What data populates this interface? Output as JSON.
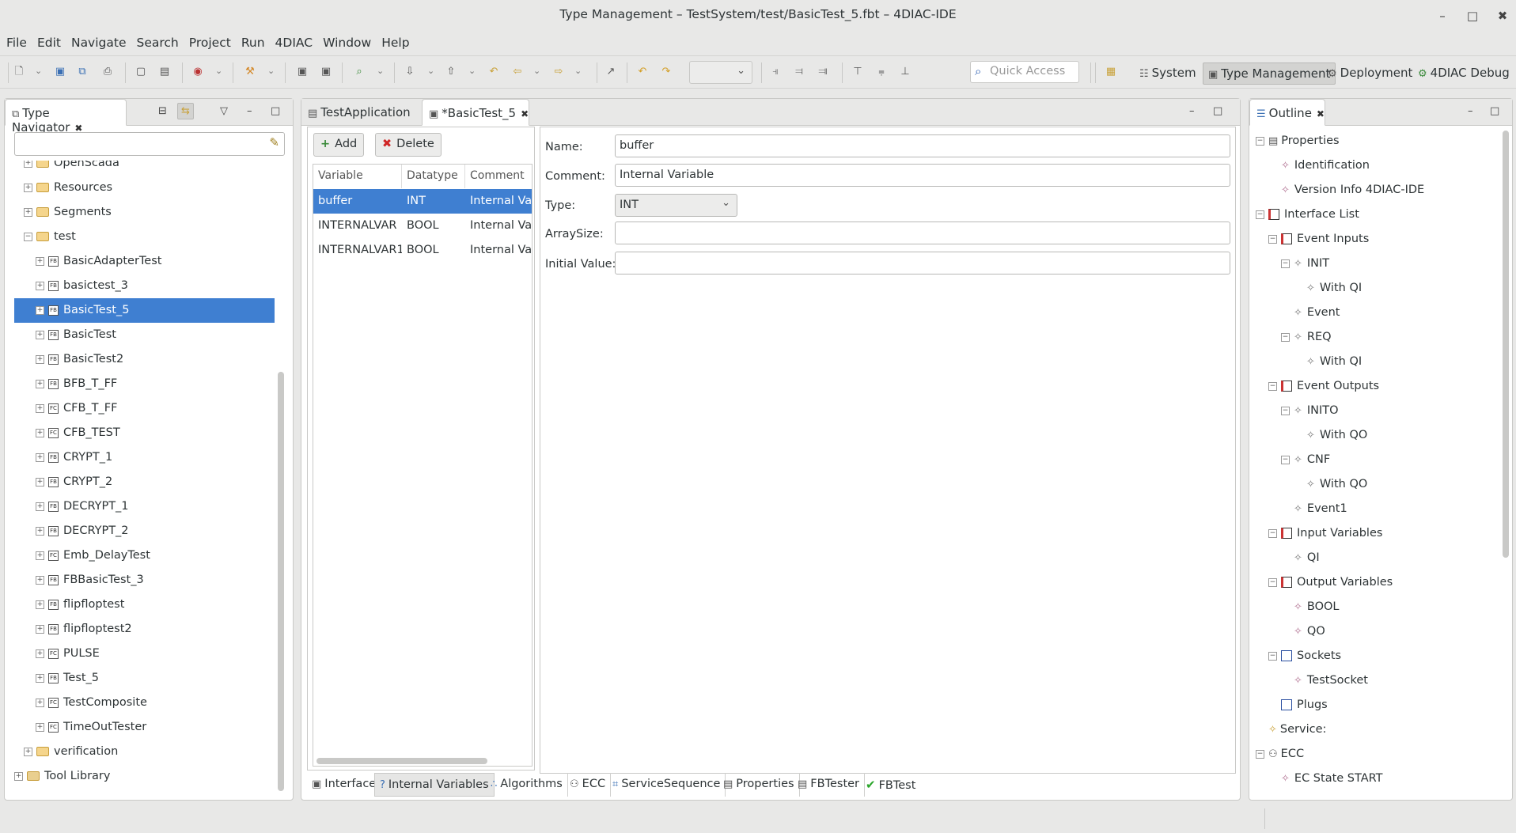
{
  "window": {
    "title": "Type Management – TestSystem/test/BasicTest_5.fbt – 4DIAC-IDE",
    "minimize": "–",
    "maximize": "□",
    "close": "✖"
  },
  "menu": [
    "File",
    "Edit",
    "Navigate",
    "Search",
    "Project",
    "Run",
    "4DIAC",
    "Window",
    "Help"
  ],
  "toolbar": {
    "quick_access_placeholder": "Quick Access",
    "perspectives": [
      "System",
      "Type Management",
      "Deployment",
      "4DIAC Debug"
    ],
    "active_perspective": "Type Management"
  },
  "type_navigator": {
    "title": "Type Navigator",
    "filter_value": "",
    "items": [
      {
        "label": "OpenScada",
        "kind": "folder",
        "level": 1
      },
      {
        "label": "Resources",
        "kind": "folder",
        "level": 1
      },
      {
        "label": "Segments",
        "kind": "folder",
        "level": 1
      },
      {
        "label": "test",
        "kind": "folder",
        "level": 1,
        "expanded": true
      },
      {
        "label": "BasicAdapterTest",
        "kind": "FB",
        "level": 2
      },
      {
        "label": "basictest_3",
        "kind": "FB",
        "level": 2
      },
      {
        "label": "BasicTest_5",
        "kind": "FB",
        "level": 2,
        "selected": true
      },
      {
        "label": "BasicTest",
        "kind": "FB",
        "level": 2
      },
      {
        "label": "BasicTest2",
        "kind": "FB",
        "level": 2
      },
      {
        "label": "BFB_T_FF",
        "kind": "FB",
        "level": 2
      },
      {
        "label": "CFB_T_FF",
        "kind": "FC",
        "level": 2
      },
      {
        "label": "CFB_TEST",
        "kind": "FC",
        "level": 2
      },
      {
        "label": "CRYPT_1",
        "kind": "FB",
        "level": 2
      },
      {
        "label": "CRYPT_2",
        "kind": "FB",
        "level": 2
      },
      {
        "label": "DECRYPT_1",
        "kind": "FB",
        "level": 2
      },
      {
        "label": "DECRYPT_2",
        "kind": "FB",
        "level": 2
      },
      {
        "label": "Emb_DelayTest",
        "kind": "FC",
        "level": 2
      },
      {
        "label": "FBBasicTest_3",
        "kind": "FB",
        "level": 2
      },
      {
        "label": "flipfloptest",
        "kind": "FB",
        "level": 2
      },
      {
        "label": "flipfloptest2",
        "kind": "FB",
        "level": 2
      },
      {
        "label": "PULSE",
        "kind": "FC",
        "level": 2
      },
      {
        "label": "Test_5",
        "kind": "FB",
        "level": 2
      },
      {
        "label": "TestComposite",
        "kind": "FC",
        "level": 2
      },
      {
        "label": "TimeOutTester",
        "kind": "FC",
        "level": 2
      },
      {
        "label": "verification",
        "kind": "folder",
        "level": 1
      },
      {
        "label": "Tool Library",
        "kind": "library",
        "level": 0
      }
    ]
  },
  "editor": {
    "tabs": [
      {
        "label": "TestApplication",
        "active": false
      },
      {
        "label": "*BasicTest_5",
        "active": true
      }
    ],
    "add_label": "Add",
    "delete_label": "Delete",
    "table": {
      "columns": [
        "Variable",
        "Datatype",
        "Comment"
      ],
      "rows": [
        {
          "variable": "buffer",
          "datatype": "INT",
          "comment": "Internal Vari",
          "selected": true
        },
        {
          "variable": "INTERNALVAR",
          "datatype": "BOOL",
          "comment": "Internal Vari",
          "selected": false
        },
        {
          "variable": "INTERNALVAR1",
          "datatype": "BOOL",
          "comment": "Internal Vari",
          "selected": false
        }
      ]
    },
    "form": {
      "name_label": "Name:",
      "name_value": "buffer",
      "comment_label": "Comment:",
      "comment_value": "Internal Variable",
      "type_label": "Type:",
      "type_value": "INT",
      "arraysize_label": "ArraySize:",
      "arraysize_value": "",
      "initial_label": "Initial Value:",
      "initial_value": ""
    },
    "bottom_tabs": [
      {
        "label": "Interface",
        "active": false
      },
      {
        "label": "Internal Variables",
        "active": true
      },
      {
        "label": "Algorithms",
        "active": false
      },
      {
        "label": "ECC",
        "active": false
      },
      {
        "label": "ServiceSequence",
        "active": false
      },
      {
        "label": "Properties",
        "active": false
      },
      {
        "label": "FBTester",
        "active": false
      },
      {
        "label": "FBTest",
        "active": false
      }
    ]
  },
  "outline": {
    "title": "Outline",
    "items": [
      {
        "label": "Properties",
        "level": 0,
        "icon": "properties-icon"
      },
      {
        "label": "Identification",
        "level": 1,
        "icon": "diamond-icon"
      },
      {
        "label": "Version Info 4DIAC-IDE",
        "level": 1,
        "icon": "diamond-icon"
      },
      {
        "label": "Interface List",
        "level": 0,
        "icon": "interface-icon"
      },
      {
        "label": "Event Inputs",
        "level": 1,
        "icon": "interface-icon"
      },
      {
        "label": "INIT",
        "level": 2,
        "icon": "event-icon"
      },
      {
        "label": "With QI",
        "level": 3,
        "icon": "event-icon"
      },
      {
        "label": "Event",
        "level": 2,
        "icon": "event-icon"
      },
      {
        "label": "REQ",
        "level": 2,
        "icon": "event-icon"
      },
      {
        "label": "With QI",
        "level": 3,
        "icon": "event-icon"
      },
      {
        "label": "Event Outputs",
        "level": 1,
        "icon": "interface-icon"
      },
      {
        "label": "INITO",
        "level": 2,
        "icon": "event-icon"
      },
      {
        "label": "With QO",
        "level": 3,
        "icon": "event-icon"
      },
      {
        "label": "CNF",
        "level": 2,
        "icon": "event-icon"
      },
      {
        "label": "With QO",
        "level": 3,
        "icon": "event-icon"
      },
      {
        "label": "Event1",
        "level": 2,
        "icon": "event-icon"
      },
      {
        "label": "Input Variables",
        "level": 1,
        "icon": "interface-icon"
      },
      {
        "label": "QI",
        "level": 2,
        "icon": "event-icon"
      },
      {
        "label": "Output Variables",
        "level": 1,
        "icon": "interface-icon"
      },
      {
        "label": "BOOL",
        "level": 2,
        "icon": "diamond-icon"
      },
      {
        "label": "QO",
        "level": 2,
        "icon": "diamond-icon"
      },
      {
        "label": "Sockets",
        "level": 1,
        "icon": "socket-icon"
      },
      {
        "label": "TestSocket",
        "level": 2,
        "icon": "diamond-icon"
      },
      {
        "label": "Plugs",
        "level": 1,
        "icon": "plug-icon"
      },
      {
        "label": "Service:",
        "level": 1,
        "icon": "service-icon"
      },
      {
        "label": "ECC",
        "level": 0,
        "icon": "ecc-icon"
      },
      {
        "label": "EC State START",
        "level": 1,
        "icon": "diamond-icon"
      }
    ]
  }
}
